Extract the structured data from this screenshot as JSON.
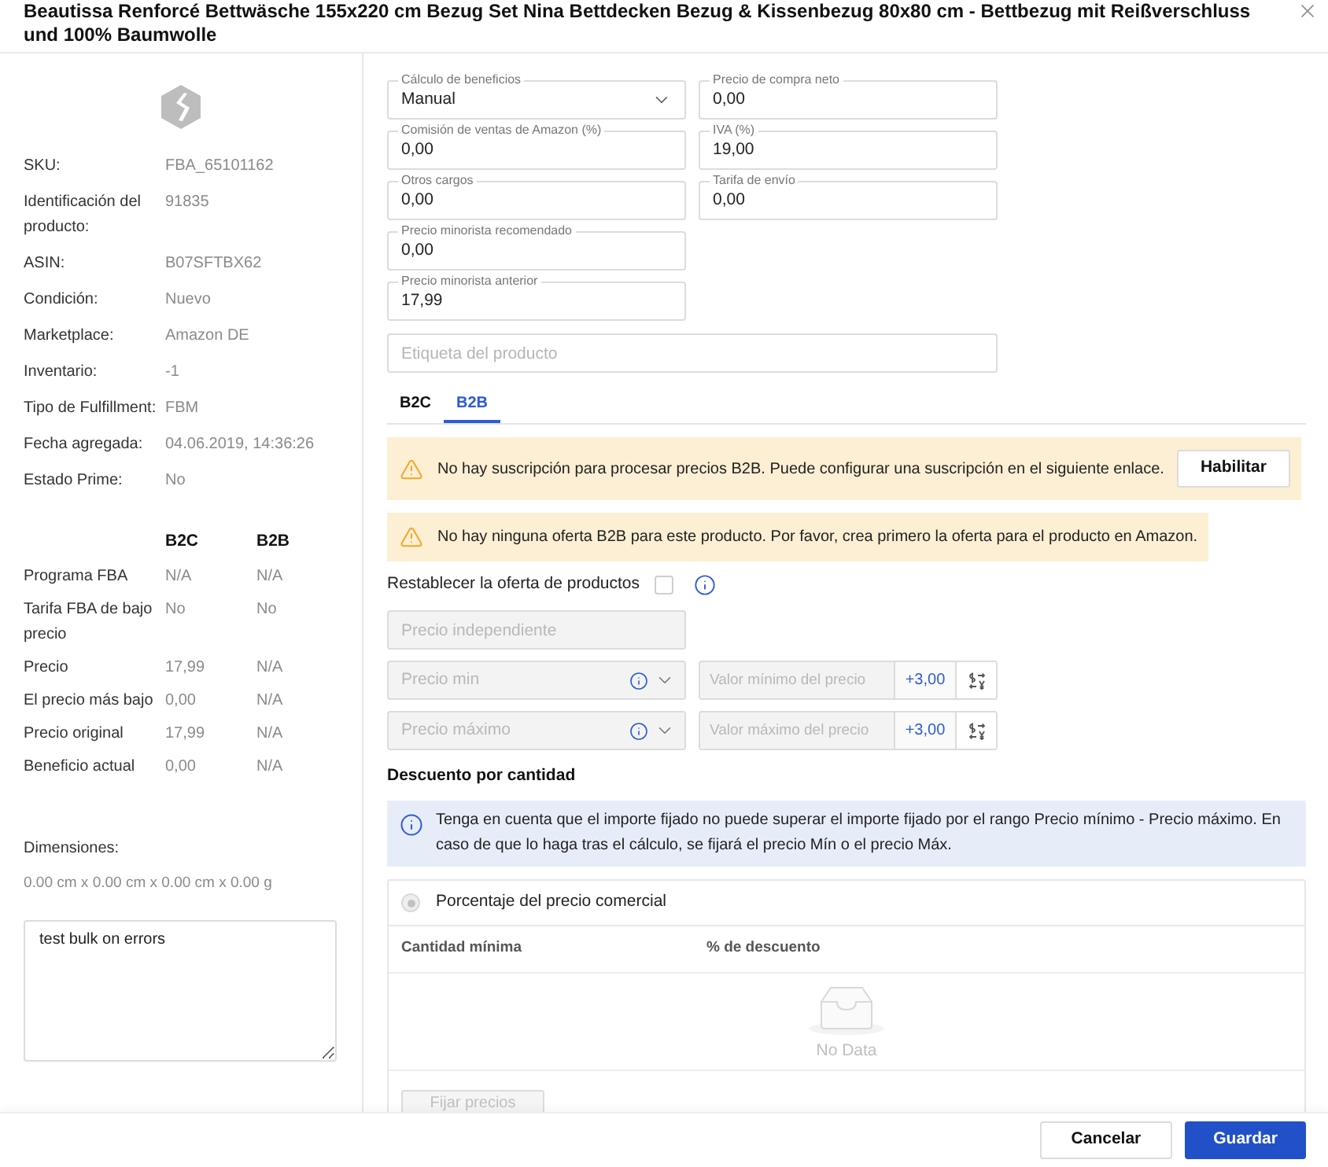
{
  "dialog": {
    "title": "Beautissa Renforcé Bettwäsche 155x220 cm Bezug Set Nina Bettdecken Bezug & Kissenbezug 80x80 cm - Bettbezug mit Reißverschluss und 100% Baumwolle"
  },
  "product_info": [
    {
      "label": "SKU:",
      "value": "FBA_65101162"
    },
    {
      "label": "Identificación del producto:",
      "value": "91835"
    },
    {
      "label": "ASIN:",
      "value": "B07SFTBX62"
    },
    {
      "label": "Condición:",
      "value": "Nuevo"
    },
    {
      "label": "Marketplace:",
      "value": "Amazon DE"
    },
    {
      "label": "Inventario:",
      "value": "-1"
    },
    {
      "label": "Tipo de Fulfillment:",
      "value": "FBM"
    },
    {
      "label": "Fecha agregada:",
      "value": "04.06.2019, 14:36:26"
    },
    {
      "label": "Estado Prime:",
      "value": "No"
    }
  ],
  "channel_table": {
    "columns": [
      "B2C",
      "B2B"
    ],
    "rows": [
      {
        "label": "Programa FBA",
        "values": [
          "N/A",
          "N/A"
        ]
      },
      {
        "label": "Tarifa FBA de bajo precio",
        "values": [
          "No",
          "No"
        ]
      },
      {
        "label": "Precio",
        "values": [
          "17,99",
          "N/A"
        ]
      },
      {
        "label": "El precio más bajo",
        "values": [
          "0,00",
          "N/A"
        ]
      },
      {
        "label": "Precio original",
        "values": [
          "17,99",
          "N/A"
        ]
      },
      {
        "label": "Beneficio actual",
        "values": [
          "0,00",
          "N/A"
        ]
      }
    ]
  },
  "dimensions": {
    "label": "Dimensiones:",
    "value": "0.00 cm x 0.00 cm x 0.00 cm x 0.00 g"
  },
  "notes": {
    "value": "test bulk on errors"
  },
  "pricing_fields": {
    "left": [
      {
        "kind": "select",
        "label": "Cálculo de beneficios",
        "value": "Manual"
      },
      {
        "kind": "input",
        "label": "Comisión de ventas de Amazon (%)",
        "value": "0,00"
      },
      {
        "kind": "input",
        "label": "Otros cargos",
        "value": "0,00"
      },
      {
        "kind": "input",
        "label": "Precio minorista recomendado",
        "value": "0,00"
      },
      {
        "kind": "input",
        "label": "Precio minorista anterior",
        "value": "17,99"
      }
    ],
    "right": [
      {
        "kind": "input",
        "label": "Precio de compra neto",
        "value": "0,00"
      },
      {
        "kind": "input",
        "label": "IVA (%)",
        "value": "19,00"
      },
      {
        "kind": "input",
        "label": "Tarifa de envío",
        "value": "0,00"
      }
    ]
  },
  "product_label": {
    "placeholder": "Etiqueta del producto"
  },
  "tabs": [
    {
      "label": "B2C",
      "selected": false
    },
    {
      "label": "B2B",
      "selected": true
    }
  ],
  "alerts": [
    {
      "kind": "warning",
      "text": "No hay suscripción para procesar precios B2B. Puede configurar una suscripción en el siguiente enlace.",
      "button": "Habilitar"
    },
    {
      "kind": "warning",
      "text": "No hay ninguna oferta B2B para este producto. Por favor, crea primero la oferta para el producto en Amazon."
    }
  ],
  "reset_offer": {
    "label": "Restablecer la oferta de productos",
    "checked": false
  },
  "independent_price": {
    "placeholder": "Precio independiente",
    "disabled": true
  },
  "price_limits": [
    {
      "placeholder": "Precio min",
      "value_placeholder": "Valor mínimo del precio",
      "adjustment": "+3,00",
      "disabled": true
    },
    {
      "placeholder": "Precio máximo",
      "value_placeholder": "Valor máximo del precio",
      "adjustment": "+3,00",
      "disabled": true
    }
  ],
  "quantity_discount": {
    "title": "Descuento por cantidad",
    "info": "Tenga en cuenta que el importe fijado no puede superar el importe fijado por el rango Precio mínimo - Precio máximo. En caso de que lo haga tras el cálculo, se fijará el precio Mín o el precio Máx.",
    "option": {
      "label": "Porcentaje del precio comercial",
      "selected": true,
      "disabled": true
    },
    "columns": [
      "Cantidad mínima",
      "% de descuento"
    ],
    "empty_text": "No Data",
    "button": {
      "label": "Fijar precios",
      "disabled": true
    }
  },
  "footer": {
    "buttons": [
      {
        "kind": "secondary",
        "label": "Cancelar"
      },
      {
        "kind": "primary",
        "label": "Guardar"
      }
    ]
  }
}
